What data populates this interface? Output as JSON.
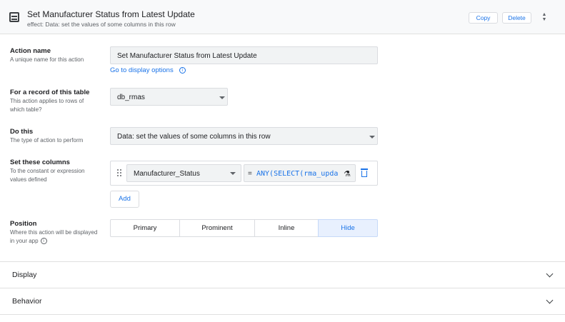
{
  "header": {
    "title": "Set Manufacturer Status from Latest Update",
    "subtitle": "effect: Data: set the values of some columns in this row",
    "copy_label": "Copy",
    "delete_label": "Delete"
  },
  "action_name": {
    "label": "Action name",
    "description": "A unique name for this action",
    "value": "Set Manufacturer Status from Latest Update",
    "display_link": "Go to display options"
  },
  "table": {
    "label": "For a record of this table",
    "description": "This action applies to rows of which table?",
    "value": "db_rmas"
  },
  "do_this": {
    "label": "Do this",
    "description": "The type of action to perform",
    "value": "Data: set the values of some columns in this row"
  },
  "columns": {
    "label": "Set these columns",
    "description": "To the constant or expression values defined",
    "rows": [
      {
        "column": "Manufacturer_Status",
        "equals": "=",
        "expression": "ANY(SELECT(rma_upda"
      }
    ],
    "add_label": "Add"
  },
  "position": {
    "label": "Position",
    "description": "Where this action will be displayed in your app",
    "options": [
      "Primary",
      "Prominent",
      "Inline",
      "Hide"
    ],
    "selected": "Hide"
  },
  "sections": [
    {
      "title": "Display"
    },
    {
      "title": "Behavior"
    }
  ],
  "colors": {
    "accent": "#1a73e8",
    "selected_bg": "#e8f0fe",
    "field_bg": "#f1f3f4"
  },
  "icons": {
    "header": "action-icon",
    "sort": "unfold-icon",
    "info": "info-icon",
    "drag": "drag-handle-icon",
    "dropdown": "dropdown-caret-icon",
    "expression": "flask-icon",
    "delete": "trash-icon",
    "expand": "chevron-down-icon"
  }
}
